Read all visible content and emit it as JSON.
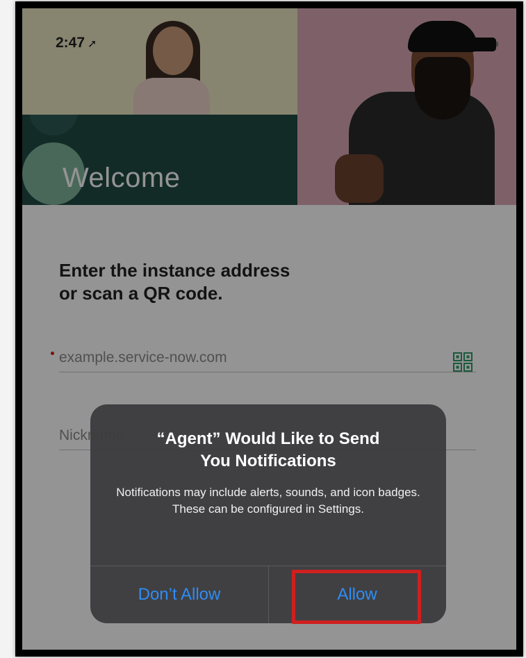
{
  "status_bar": {
    "time": "2:47",
    "location_arrow": "➚"
  },
  "hero": {
    "welcome": "Welcome"
  },
  "form": {
    "prompt_line1": "Enter the instance address",
    "prompt_line2": "or scan a QR code.",
    "instance_placeholder": "example.service-now.com",
    "nickname_placeholder": "Nickname"
  },
  "alert": {
    "title_line1": "“Agent” Would Like to Send",
    "title_line2": "You Notifications",
    "message": "Notifications may include alerts, sounds, and icon badges. These can be configured in Settings.",
    "dont_allow_label": "Don’t Allow",
    "allow_label": "Allow"
  },
  "colors": {
    "accent_blue": "#2f8cf6",
    "highlight_red": "#d01f1f",
    "hero_green": "#1f4a44"
  }
}
